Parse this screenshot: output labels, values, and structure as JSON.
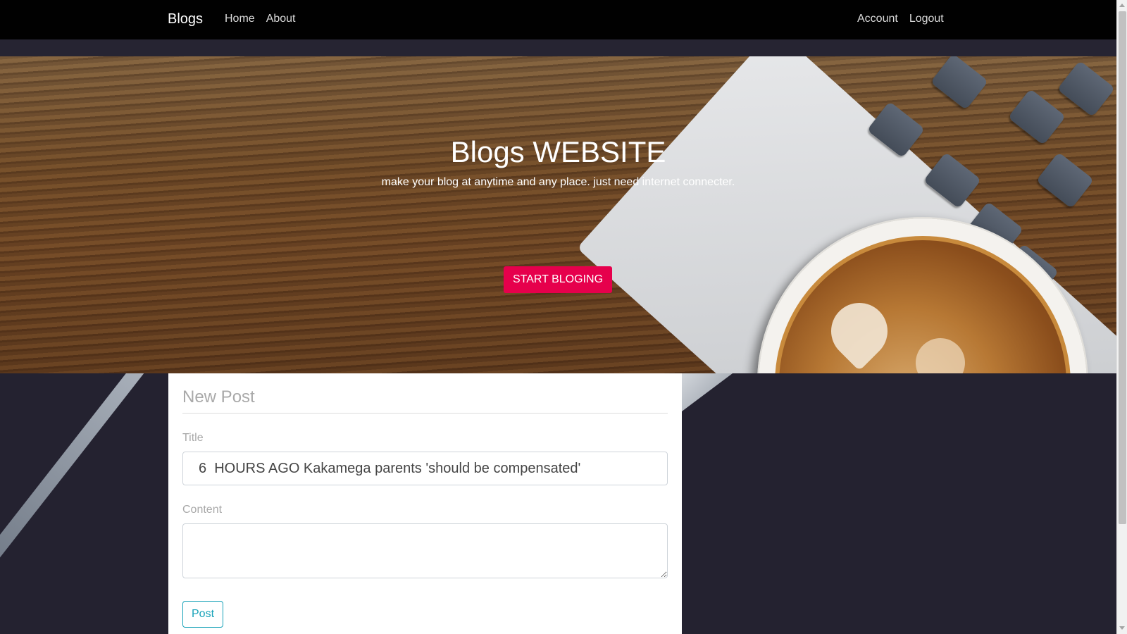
{
  "navbar": {
    "brand": "Blogs",
    "links_left": [
      {
        "label": "Home"
      },
      {
        "label": "About"
      }
    ],
    "links_right": [
      {
        "label": "Account"
      },
      {
        "label": "Logout"
      }
    ]
  },
  "hero": {
    "title": "Blogs WEBSITE",
    "subtitle": "make your blog at anytime and any place. just need internet connecter.",
    "button_label": "START BLOGING"
  },
  "form": {
    "heading": "New Post",
    "title_label": "Title",
    "title_value": "6  HOURS AGO Kakamega parents 'should be compensated'",
    "content_label": "Content",
    "content_value": "",
    "submit_label": "Post"
  },
  "colors": {
    "navbar_bg": "#010101",
    "accent_button": "#e6004c",
    "post_button": "#17a2b8",
    "page_bg": "#242230"
  }
}
